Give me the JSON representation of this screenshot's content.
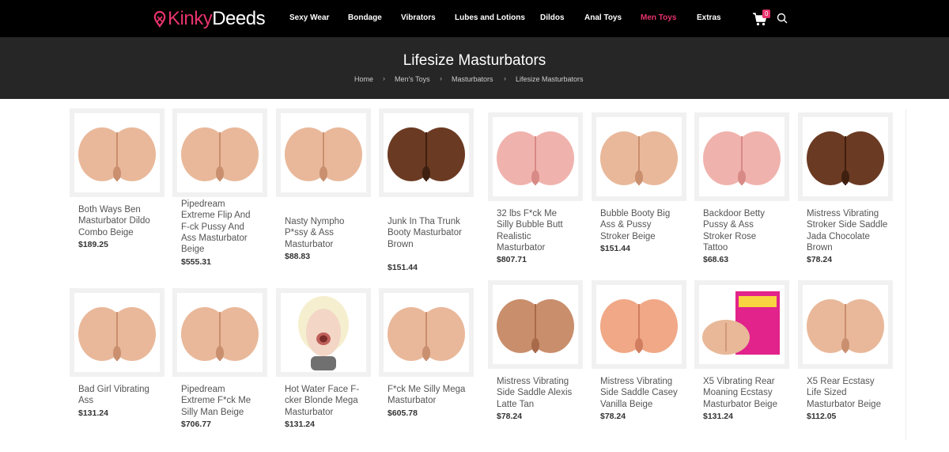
{
  "logo": {
    "part1": "Kinky",
    "part2": "Deeds"
  },
  "nav": {
    "items": [
      {
        "label": "Sexy Wear"
      },
      {
        "label": "Bondage"
      },
      {
        "label": "Vibrators"
      },
      {
        "label": "Lubes and Lotions"
      },
      {
        "label": "Dildos"
      },
      {
        "label": "Anal Toys"
      },
      {
        "label": "Men Toys"
      },
      {
        "label": "Extras"
      }
    ],
    "active": "Men Toys",
    "cart_count": "0"
  },
  "page": {
    "title": "Lifesize Masturbators",
    "breadcrumb": [
      "Home",
      "Men's Toys",
      "Masturbators",
      "Lifesize Masturbators"
    ],
    "separator": "›"
  },
  "products": [
    {
      "name": "Both Ways Ben Masturbator Dildo Combo Beige",
      "price": "$189.25"
    },
    {
      "name": "Pipedream Extreme Flip And F-ck Pussy And Ass Masturbator Beige",
      "price": "$555.31"
    },
    {
      "name": "Nasty Nympho P*ssy & Ass Masturbator",
      "price": "$88.83"
    },
    {
      "name": "Junk In Tha Trunk Booty Masturbator Brown",
      "price": "$151.44"
    },
    {
      "name": "32 lbs F*ck Me Silly Bubble Butt Realistic Masturbator",
      "price": "$807.71"
    },
    {
      "name": "Bubble Booty Big Ass & Pussy Stroker Beige",
      "price": "$151.44"
    },
    {
      "name": "Backdoor Betty Pussy & Ass Stroker Rose Tattoo",
      "price": "$68.63"
    },
    {
      "name": "Mistress Vibrating Stroker Side Saddle Jada Chocolate Brown",
      "price": "$78.24"
    },
    {
      "name": "Bad Girl Vibrating Ass",
      "price": "$131.24"
    },
    {
      "name": "Pipedream Extreme F*ck Me Silly Man Beige",
      "price": "$706.77"
    },
    {
      "name": "Hot Water Face F-cker Blonde Mega Masturbator",
      "price": "$131.24"
    },
    {
      "name": "F*ck Me Silly Mega Masturbator",
      "price": "$605.78"
    },
    {
      "name": "Mistress Vibrating Side Saddle Alexis Latte Tan",
      "price": "$78.24"
    },
    {
      "name": "Mistress Vibrating Side Saddle Casey Vanilla Beige",
      "price": "$78.24"
    },
    {
      "name": "X5 Vibrating Rear Moaning Ecstasy Masturbator Beige",
      "price": "$131.24"
    },
    {
      "name": "X5 Rear Ecstasy Life Sized Masturbator Beige",
      "price": "$112.05"
    }
  ],
  "colors": {
    "accent": "#e8336c",
    "header_bg": "#000000",
    "band_bg": "#262626",
    "product_skin": "#e8b898",
    "product_brown": "#6b3a22",
    "product_pink": "#f0b0b0"
  },
  "icons": {
    "cart": "shopping-cart-icon",
    "search": "search-icon"
  }
}
